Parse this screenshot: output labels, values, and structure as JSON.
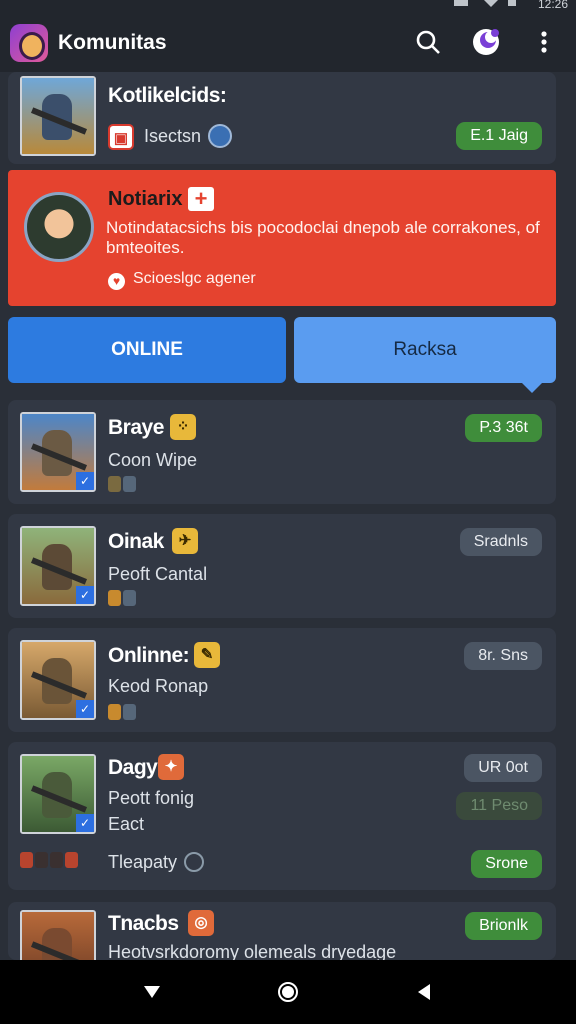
{
  "status": {
    "time": "12:26"
  },
  "app": {
    "title": "Komunitas"
  },
  "top_card": {
    "name": "Kotlikelcids:",
    "subtitle": "Isectsn",
    "pill": "E.1 Jaig"
  },
  "notice": {
    "title": "Notiarix",
    "body": "Notindatacsichs bis pocodoclai dnepob ale corrakones, of bmteoites.",
    "footer": "Scioeslgc agener"
  },
  "tabs": {
    "online": "ONLINE",
    "other": "Racksa"
  },
  "players": [
    {
      "name": "Braye",
      "status": "Coon Wipe",
      "pill": "P.3 36t"
    },
    {
      "name": "Oinak",
      "status": "Peoft Cantal",
      "pill": "Sradnls"
    },
    {
      "name": "Onlinne:",
      "status": "Keod Ronap",
      "pill": "8r. Sns"
    },
    {
      "name": "Dagy",
      "status": "Peott fonig",
      "status2": "Eact",
      "pill": "UR 0ot",
      "pill2": "11 Peso",
      "foot": "Tleapaty",
      "pill3": "Srone"
    },
    {
      "name": "Tnacbs",
      "status": "Heotvsrkdoromy olemeals dryedage",
      "pill": "Brionlk"
    }
  ],
  "colors": {
    "accent_red": "#e5432f",
    "accent_blue": "#2d7be0",
    "green": "#3f8d3b",
    "card": "#323844"
  }
}
